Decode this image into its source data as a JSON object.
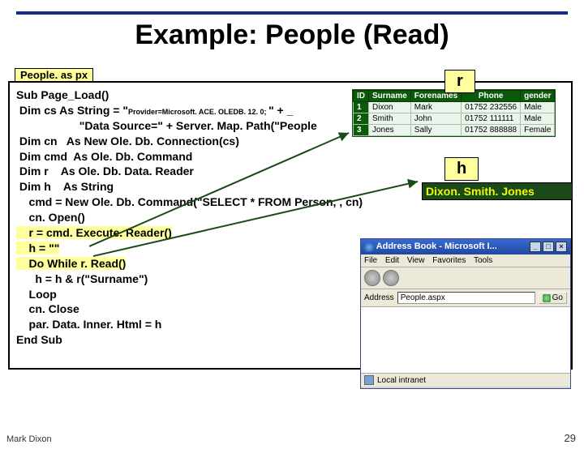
{
  "title": "Example: People (Read)",
  "file_label": "People. as\npx",
  "code": {
    "l1": "Sub Page_Load()",
    "l2a": " Dim cs As String = \"",
    "l2b": "Provider=Microsoft. ACE. OLEDB. 12. 0; ",
    "l2c": "\" + _",
    "l3": "                    \"Data Source=\" + Server. Map. Path(\"People",
    "l4": " Dim cn   As New Ole. Db. Connection(cs)",
    "l5": " Dim cmd  As Ole. Db. Command",
    "l6": " Dim r    As Ole. Db. Data. Reader",
    "l7": " Dim h    As String",
    "l8": "    cmd = New Ole. Db. Command(\"SELECT * FROM Person, , cn)",
    "l9": "    cn. Open()",
    "l10": "    r = cmd. Execute. Reader()",
    "l11": "    h = \"\"",
    "l12": "    Do While r. Read()",
    "l13": "      h = h & r(\"Surname\")",
    "l14": "    Loop",
    "l15": "    cn. Close",
    "l16": "    par. Data. Inner. Html = h",
    "l17": "End Sub"
  },
  "labels": {
    "r": "r",
    "h": "h"
  },
  "h_value": "Dixon. Smith. Jones",
  "table": {
    "headers": [
      "ID",
      "Surname",
      "Forenames",
      "Phone",
      "gender"
    ],
    "rows": [
      [
        "1",
        "Dixon",
        "Mark",
        "01752 232556",
        "Male"
      ],
      [
        "2",
        "Smith",
        "John",
        "01752 111111",
        "Male"
      ],
      [
        "3",
        "Jones",
        "Sally",
        "01752 888888",
        "Female"
      ]
    ]
  },
  "browser": {
    "title": "Address Book - Microsoft I...",
    "menu": [
      "File",
      "Edit",
      "View",
      "Favorites",
      "Tools"
    ],
    "address_label": "Address",
    "address_value": "People.aspx",
    "go_label": "Go",
    "status": "Local intranet"
  },
  "footer": {
    "author": "Mark Dixon",
    "page": "29"
  }
}
